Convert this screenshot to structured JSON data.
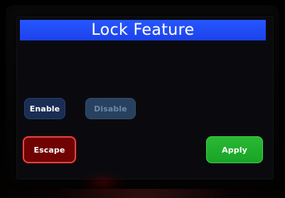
{
  "screen": {
    "title": "Lock Feature"
  },
  "buttons": {
    "enable_label": "Enable",
    "disable_label": "Disable",
    "escape_label": "Escape",
    "apply_label": "Apply"
  },
  "colors": {
    "title_bar": "#2656ff",
    "enable_button": "#1a2d52",
    "disable_button": "#27415f",
    "escape_button": "#700202",
    "apply_button": "#2ab935"
  }
}
